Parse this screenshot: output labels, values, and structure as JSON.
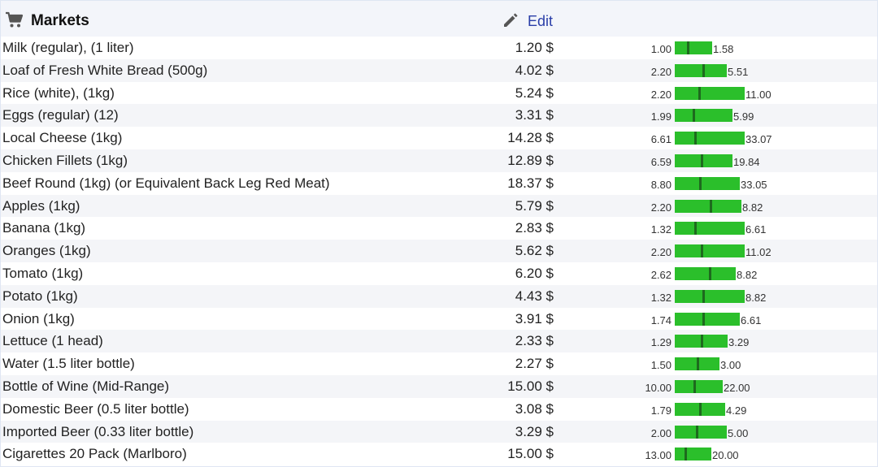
{
  "header": {
    "title": "Markets",
    "edit_label": "Edit",
    "cart_icon": "shopping-cart-icon",
    "edit_icon": "pencil-icon"
  },
  "colors": {
    "header_bg": "#f3f5fa",
    "bar_green": "#2bbf2b",
    "tick_dark": "#1e6a1e",
    "link_blue": "#2a3ea8"
  },
  "items": [
    {
      "name": "Milk (regular), (1 liter)",
      "price": "1.20 $",
      "min": "1.00",
      "max": "1.58",
      "min_v": 1.0,
      "max_v": 1.58,
      "val_v": 1.2
    },
    {
      "name": "Loaf of Fresh White Bread (500g)",
      "price": "4.02 $",
      "min": "2.20",
      "max": "5.51",
      "min_v": 2.2,
      "max_v": 5.51,
      "val_v": 4.02
    },
    {
      "name": "Rice (white), (1kg)",
      "price": "5.24 $",
      "min": "2.20",
      "max": "11.00",
      "min_v": 2.2,
      "max_v": 11.0,
      "val_v": 5.24
    },
    {
      "name": "Eggs (regular) (12)",
      "price": "3.31 $",
      "min": "1.99",
      "max": "5.99",
      "min_v": 1.99,
      "max_v": 5.99,
      "val_v": 3.31
    },
    {
      "name": "Local Cheese (1kg)",
      "price": "14.28 $",
      "min": "6.61",
      "max": "33.07",
      "min_v": 6.61,
      "max_v": 33.07,
      "val_v": 14.28
    },
    {
      "name": "Chicken Fillets (1kg)",
      "price": "12.89 $",
      "min": "6.59",
      "max": "19.84",
      "min_v": 6.59,
      "max_v": 19.84,
      "val_v": 12.89
    },
    {
      "name": "Beef Round (1kg) (or Equivalent Back Leg Red Meat)",
      "price": "18.37 $",
      "min": "8.80",
      "max": "33.05",
      "min_v": 8.8,
      "max_v": 33.05,
      "val_v": 18.37
    },
    {
      "name": "Apples (1kg)",
      "price": "5.79 $",
      "min": "2.20",
      "max": "8.82",
      "min_v": 2.2,
      "max_v": 8.82,
      "val_v": 5.79
    },
    {
      "name": "Banana (1kg)",
      "price": "2.83 $",
      "min": "1.32",
      "max": "6.61",
      "min_v": 1.32,
      "max_v": 6.61,
      "val_v": 2.83
    },
    {
      "name": "Oranges (1kg)",
      "price": "5.62 $",
      "min": "2.20",
      "max": "11.02",
      "min_v": 2.2,
      "max_v": 11.02,
      "val_v": 5.62
    },
    {
      "name": "Tomato (1kg)",
      "price": "6.20 $",
      "min": "2.62",
      "max": "8.82",
      "min_v": 2.62,
      "max_v": 8.82,
      "val_v": 6.2
    },
    {
      "name": "Potato (1kg)",
      "price": "4.43 $",
      "min": "1.32",
      "max": "8.82",
      "min_v": 1.32,
      "max_v": 8.82,
      "val_v": 4.43
    },
    {
      "name": "Onion (1kg)",
      "price": "3.91 $",
      "min": "1.74",
      "max": "6.61",
      "min_v": 1.74,
      "max_v": 6.61,
      "val_v": 3.91
    },
    {
      "name": "Lettuce (1 head)",
      "price": "2.33 $",
      "min": "1.29",
      "max": "3.29",
      "min_v": 1.29,
      "max_v": 3.29,
      "val_v": 2.33
    },
    {
      "name": "Water (1.5 liter bottle)",
      "price": "2.27 $",
      "min": "1.50",
      "max": "3.00",
      "min_v": 1.5,
      "max_v": 3.0,
      "val_v": 2.27
    },
    {
      "name": "Bottle of Wine (Mid-Range)",
      "price": "15.00 $",
      "min": "10.00",
      "max": "22.00",
      "min_v": 10.0,
      "max_v": 22.0,
      "val_v": 15.0
    },
    {
      "name": "Domestic Beer (0.5 liter bottle)",
      "price": "3.08 $",
      "min": "1.79",
      "max": "4.29",
      "min_v": 1.79,
      "max_v": 4.29,
      "val_v": 3.08
    },
    {
      "name": "Imported Beer (0.33 liter bottle)",
      "price": "3.29 $",
      "min": "2.00",
      "max": "5.00",
      "min_v": 2.0,
      "max_v": 5.0,
      "val_v": 3.29
    },
    {
      "name": "Cigarettes 20 Pack (Marlboro)",
      "price": "15.00 $",
      "min": "13.00",
      "max": "20.00",
      "min_v": 13.0,
      "max_v": 20.0,
      "val_v": 15.0
    }
  ]
}
